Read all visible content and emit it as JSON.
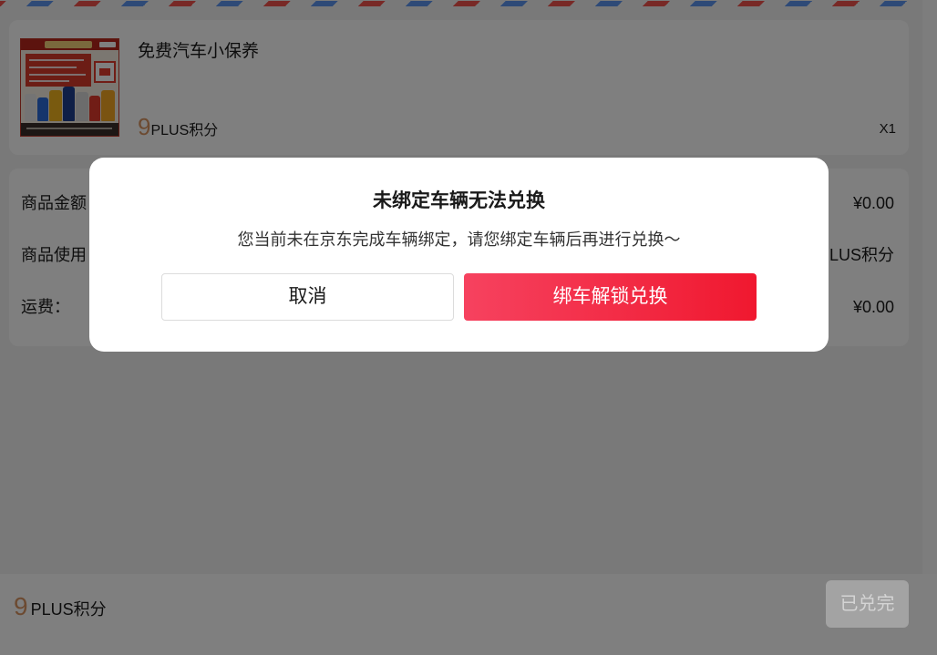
{
  "colors": {
    "stripe_red": "#f0534c",
    "stripe_blue": "#5c95ee",
    "price": "#d99563",
    "brand_start": "#f6425f",
    "brand_end": "#f0182f"
  },
  "product": {
    "image_icon": "product-thumbnail",
    "title": "免费汽车小保养",
    "price_number": "9",
    "price_unit": "PLUS积分",
    "quantity": "X1"
  },
  "summary": {
    "rows": [
      {
        "label": "商品金额",
        "value": "¥0.00"
      },
      {
        "label": "商品使用",
        "value": "LUS积分"
      },
      {
        "label": "运费：",
        "value": "¥0.00"
      }
    ]
  },
  "modal": {
    "title": "未绑定车辆无法兑换",
    "message": "您当前未在京东完成车辆绑定，请您绑定车辆后再进行兑换～",
    "cancel_label": "取消",
    "confirm_label": "绑车解锁兑换"
  },
  "footer": {
    "total_number": "9",
    "total_unit": "PLUS积分",
    "submit_label": "已兑完"
  }
}
